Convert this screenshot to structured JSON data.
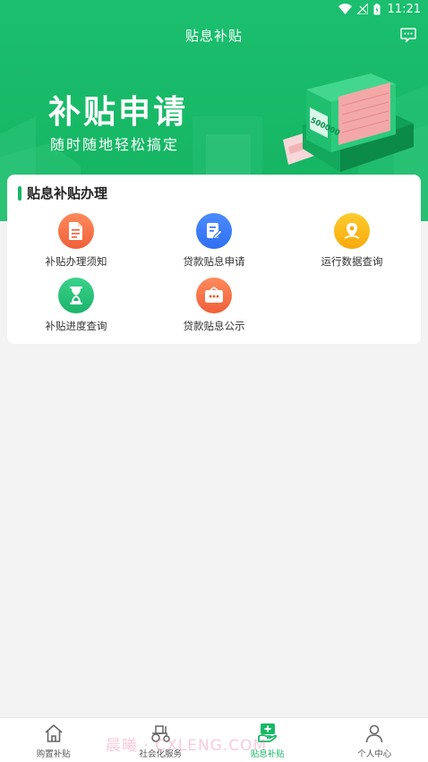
{
  "status_bar": {
    "time": "11:21"
  },
  "header": {
    "title": "贴息补贴"
  },
  "banner": {
    "title": "补贴申请",
    "subtitle": "随时随地轻松搞定",
    "illustration_amount": "500000"
  },
  "card": {
    "title": "贴息补贴办理",
    "items": [
      {
        "label": "补贴办理须知",
        "icon": "document-icon"
      },
      {
        "label": "贷款贴息申请",
        "icon": "edit-form-icon"
      },
      {
        "label": "运行数据查询",
        "icon": "location-pin-icon"
      },
      {
        "label": "补贴进度查询",
        "icon": "hourglass-icon"
      },
      {
        "label": "贷款贴息公示",
        "icon": "notice-board-icon"
      }
    ]
  },
  "tabbar": {
    "tabs": [
      {
        "label": "购置补贴",
        "icon": "home-icon"
      },
      {
        "label": "社会化服务",
        "icon": "tractor-icon"
      },
      {
        "label": "贴息补贴",
        "icon": "subsidy-icon"
      },
      {
        "label": "个人中心",
        "icon": "person-icon"
      }
    ],
    "active_index": 2
  },
  "watermark": "晨曦 · CXLENG.COM",
  "colors": {
    "primary": "#17b866",
    "orange": "#f0603a",
    "blue": "#2f6ff0",
    "yellow": "#f8a90b"
  }
}
